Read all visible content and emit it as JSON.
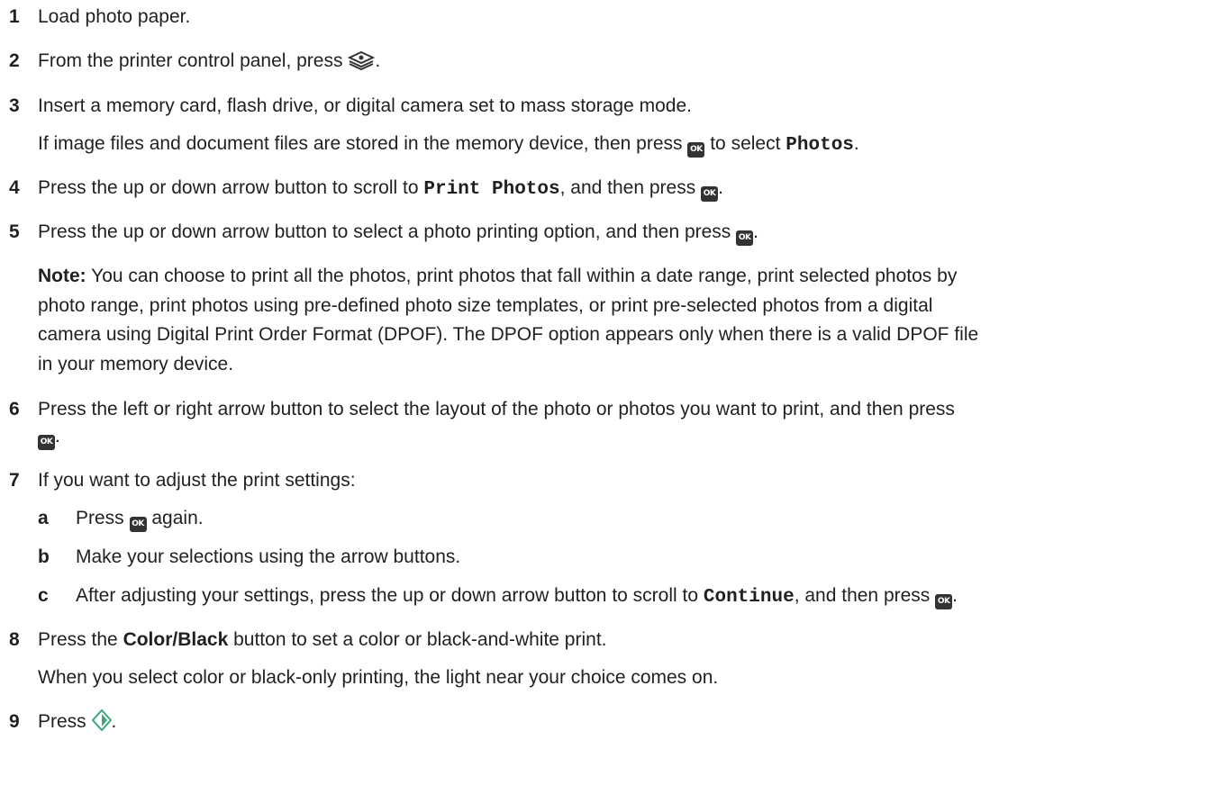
{
  "steps": [
    {
      "num": "1",
      "text": "Load photo paper."
    },
    {
      "num": "2",
      "text_before": "From the printer control panel, press",
      "text_after": ".",
      "icon": "photo-stack-icon"
    },
    {
      "num": "3",
      "text": "Insert a memory card, flash drive, or digital camera set to mass storage mode.",
      "sub_before": "If image files and document files are stored in the memory device, then press",
      "sub_middle": "to select",
      "sub_code": "Photos",
      "sub_after": "."
    },
    {
      "num": "4",
      "text_before": "Press the up or down arrow button to scroll to",
      "code": "Print Photos",
      "text_middle": ", and then press",
      "text_after": "."
    },
    {
      "num": "5",
      "text_before": "Press the up or down arrow button to select a photo printing option, and then press",
      "text_after": "."
    },
    {
      "num": "6",
      "text_line1": "Press the left or right arrow button to select the layout of the photo or photos you want to print, and then press",
      "text_after": "."
    },
    {
      "num": "7",
      "text": "If you want to adjust the print settings:"
    },
    {
      "num": "8",
      "text_before": "Press the",
      "bold": "Color/Black",
      "text_after": "button to set a color or black-and-white print.",
      "sub": "When you select color or black-only printing, the light near your choice comes on."
    },
    {
      "num": "9",
      "text_before": "Press",
      "text_after": ".",
      "icon": "start-diamond-icon"
    }
  ],
  "note": {
    "label": "Note:",
    "line1": "You can choose to print all the photos, print photos that fall within a date range, print selected photos by",
    "line2": "photo range, print photos using pre-defined photo size templates, or print pre-selected photos from a digital",
    "line3": "camera using Digital Print Order Format (DPOF). The DPOF option appears only when there is a valid DPOF file",
    "line4": "in your memory device."
  },
  "substeps": [
    {
      "letter": "a",
      "text_before": "Press",
      "text_after": "again."
    },
    {
      "letter": "b",
      "text": "Make your selections using the arrow buttons."
    },
    {
      "letter": "c",
      "text_before": "After adjusting your settings, press the up or down arrow button to scroll to",
      "code": "Continue",
      "text_middle": ", and then press",
      "text_after": "."
    }
  ],
  "ok_label": "OK",
  "colors": {
    "text": "#231f20",
    "ok_bg": "#333333",
    "start_icon": "#3aa776"
  }
}
